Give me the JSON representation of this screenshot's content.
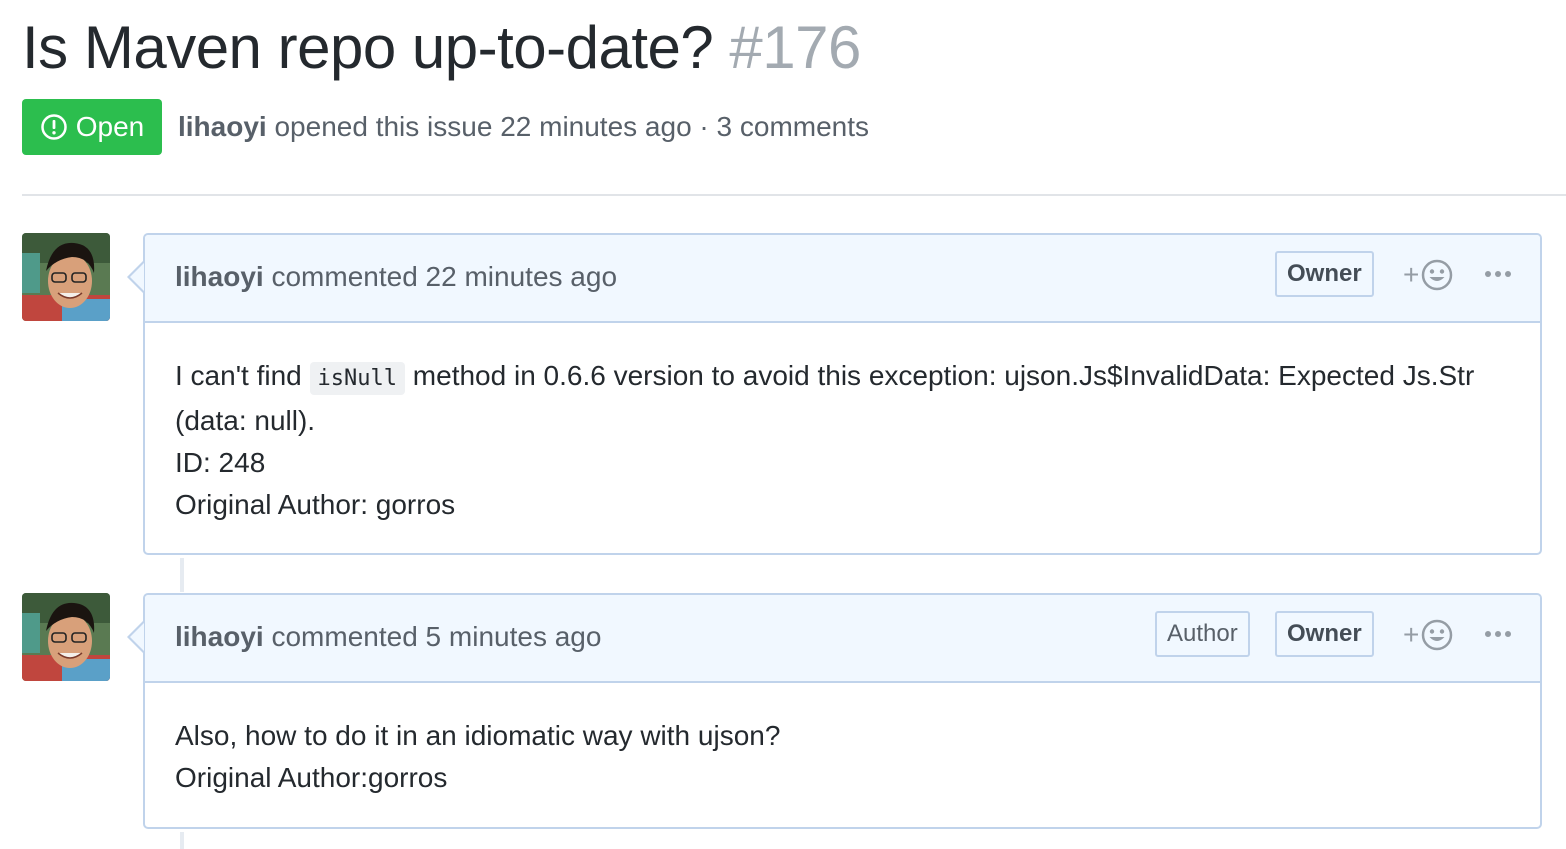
{
  "issue": {
    "title": "Is Maven repo up-to-date?",
    "number": "#176",
    "state": "Open",
    "author": "lihaoyi",
    "meta_text": " opened this issue 22 minutes ago · 3 comments"
  },
  "comments": [
    {
      "author": "lihaoyi",
      "time_text": " commented 22 minutes ago",
      "labels": [
        "Owner"
      ],
      "body": {
        "line1_before": "I can't find ",
        "line1_code": "isNull",
        "line1_after": " method in 0.6.6 version to avoid this exception: ujson.Js$InvalidData: Expected Js.Str (data: null).",
        "line2": "ID: 248",
        "line3": "Original Author: gorros"
      }
    },
    {
      "author": "lihaoyi",
      "time_text": " commented 5 minutes ago",
      "labels": [
        "Author",
        "Owner"
      ],
      "body": {
        "line1": "Also, how to do it in an idiomatic way with ujson?",
        "line2": "Original Author:gorros"
      }
    }
  ],
  "icons": {
    "state": "issue-opened-icon",
    "reaction": "smiley-icon",
    "more": "kebab-horizontal-icon"
  },
  "colors": {
    "open_green": "#2cbe4e",
    "comment_header_bg": "#f1f8ff",
    "comment_border": "#c0d3eb",
    "muted_text": "#586069",
    "issue_number": "#a3aab1"
  }
}
